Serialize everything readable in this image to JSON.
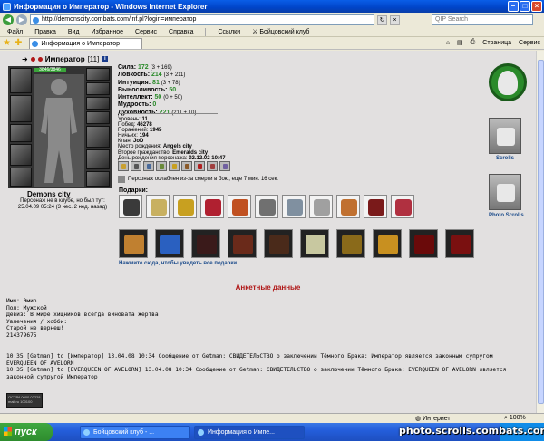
{
  "window": {
    "title": "Информация о Император - Windows Internet Explorer",
    "url": "http://demonscity.combats.com/inf.pl?login=император",
    "search_placeholder": "QIP Search"
  },
  "menu": {
    "items": [
      "Файл",
      "Правка",
      "Вид",
      "Избранное",
      "Сервис",
      "Справка"
    ],
    "links_label": "Ссылки",
    "club_link": "Бойцовский клуб"
  },
  "tabs": {
    "active_tab": "Информация о Император",
    "page_menu": "Страница",
    "tools_menu": "Сервис"
  },
  "character": {
    "name": "Император",
    "level": "[11]",
    "info_icon": "i",
    "hp": "3846/3846",
    "city_title": "Demons city",
    "presence": "Персонаж не в клубе, но был тут:",
    "last_seen": "25.04.09 05:24 (3 нес. 2 нед. назад)"
  },
  "stats": [
    {
      "label": "Сила:",
      "value": "172",
      "bonus": "(3 + 169)"
    },
    {
      "label": "Ловкость:",
      "value": "214",
      "bonus": "(3 + 211)"
    },
    {
      "label": "Интуиция:",
      "value": "81",
      "bonus": "(3 + 78)"
    },
    {
      "label": "Выносливость:",
      "value": "50",
      "bonus": ""
    },
    {
      "label": "Интеллект:",
      "value": "50",
      "bonus": "(0 + 50)"
    },
    {
      "label": "Мудрость:",
      "value": "0",
      "bonus": ""
    },
    {
      "label": "Духовность:",
      "value": "221",
      "bonus": "(211 + 10)"
    }
  ],
  "info": [
    {
      "label": "Уровень:",
      "value": "11"
    },
    {
      "label": "Побед:",
      "value": "46278"
    },
    {
      "label": "Поражений:",
      "value": "1945"
    },
    {
      "label": "Ничьих:",
      "value": "194"
    },
    {
      "label": "Клан:",
      "value": "JoD"
    },
    {
      "label": "Место рождения:",
      "value": "Angels city"
    },
    {
      "label": "Второе гражданство:",
      "value": "Emeralds city"
    },
    {
      "label": "День рождения персонажа:",
      "value": "02.12.02 10:47"
    }
  ],
  "debuff_text": "Персонаж ослаблен из-за смерти в бою, еще 7 мин. 16 сек.",
  "gifts": {
    "label": "Подарки:",
    "show_more": "Нажмите сюда, чтобы увидеть все подарки..."
  },
  "right_column": {
    "scrolls": "Scrolls",
    "photo_scrolls": "Photo Scrolls"
  },
  "profile": {
    "heading": "Анкетные данные",
    "text": "Имя: Эмир\nПол: Мужской\nДевиз: В мире хищников всегда виновата жертва.\nУвлечения / хобби:\nСтарой не вернеш!\n214379675"
  },
  "log": {
    "text": "10:35 [Getman] to [Император] 13.04.08 10:34 Сообщение от Getman: СВИДЕТЕЛЬСТВО о заключении Тёмного Брака: Император является законным супругом\nEVERQUEEN OF AVELORN\n10:35 [Getman] to [EVERQUEEN OF AVELORN] 13.04.08 10:34 Сообщение от Getman: СВИДЕТЕЛЬСТВО о заключении Тёмного Брака: EVERQUEEN OF AVELORN является\nзаконной супругой Император"
  },
  "counter_text": "OCTPA 0000 02228\nmail.ru 100100",
  "status": {
    "done": "",
    "zone": "Интернет",
    "zoom": "100%"
  },
  "taskbar": {
    "start": "пуск",
    "tasks": [
      "Бойцовский клуб - ...",
      "Информация о Импе..."
    ]
  },
  "watermark": "photo.scrolls.combats.com",
  "colors": {
    "stat_value": "#2a8a2a",
    "heading_red": "#b01818",
    "link_blue": "#1a4a8a",
    "title_blue": "#0044c8",
    "page_bg": "#e2e0e0"
  }
}
